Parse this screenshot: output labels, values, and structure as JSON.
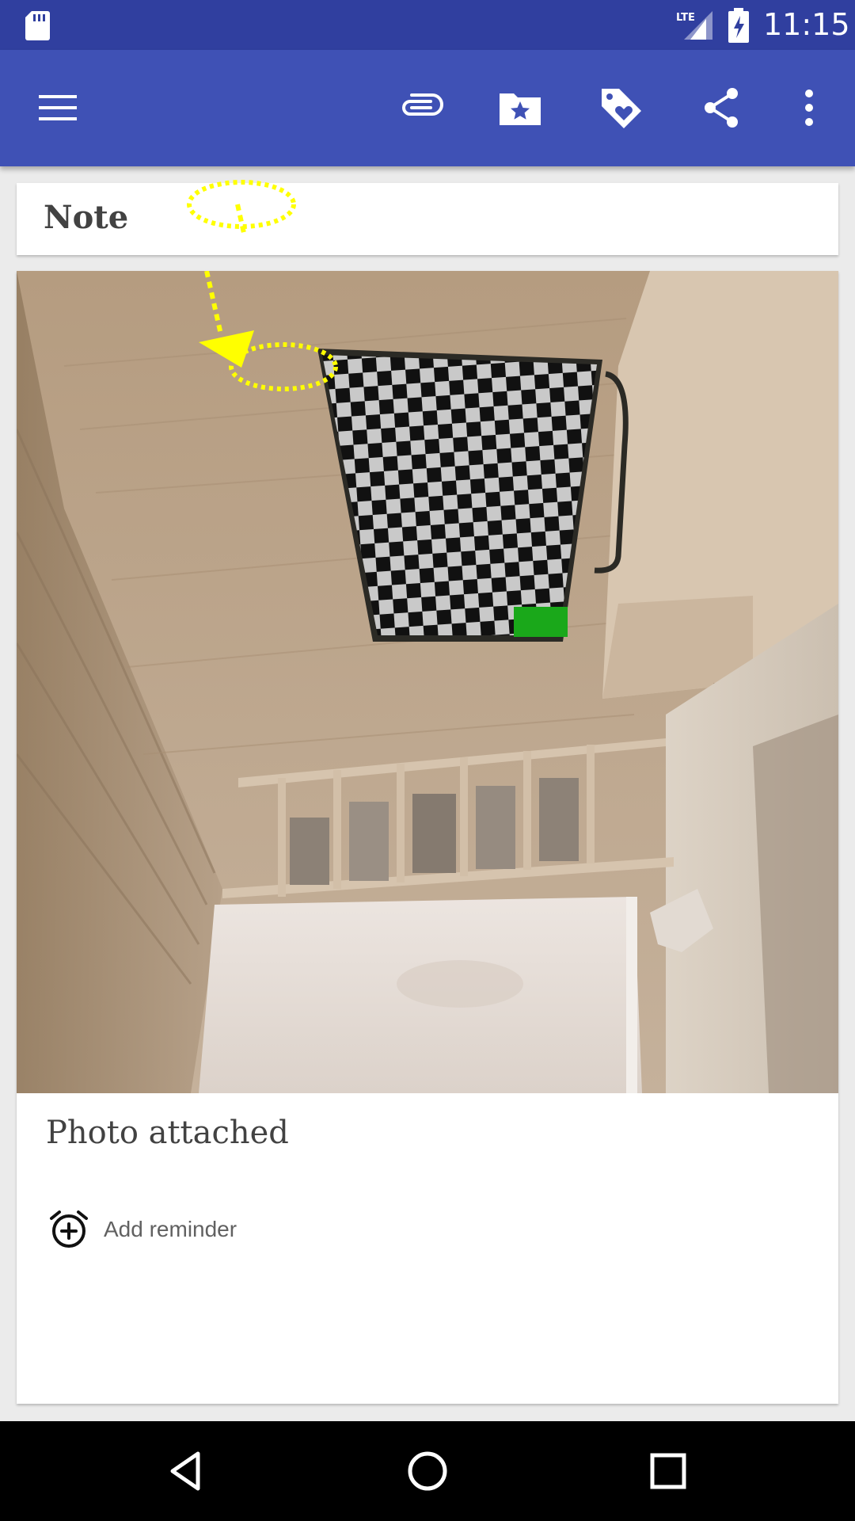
{
  "status_bar": {
    "time": "11:15",
    "network_label": "LTE",
    "icons": [
      "sd-card-icon",
      "signal-icon",
      "battery-charging-icon"
    ]
  },
  "app_bar": {
    "icons": [
      "menu-icon",
      "attachment-icon",
      "folder-star-icon",
      "tag-heart-icon",
      "share-icon",
      "more-vert-icon"
    ]
  },
  "note": {
    "title": "Note",
    "caption": "Photo attached",
    "reminder_label": "Add reminder"
  },
  "nav_bar": {
    "icons": [
      "back-icon",
      "home-icon",
      "recents-icon"
    ]
  },
  "colors": {
    "status_bar": "#303f9f",
    "app_bar": "#3f51b5",
    "annotation": "#ffff00",
    "marker": "#1aa81a"
  }
}
